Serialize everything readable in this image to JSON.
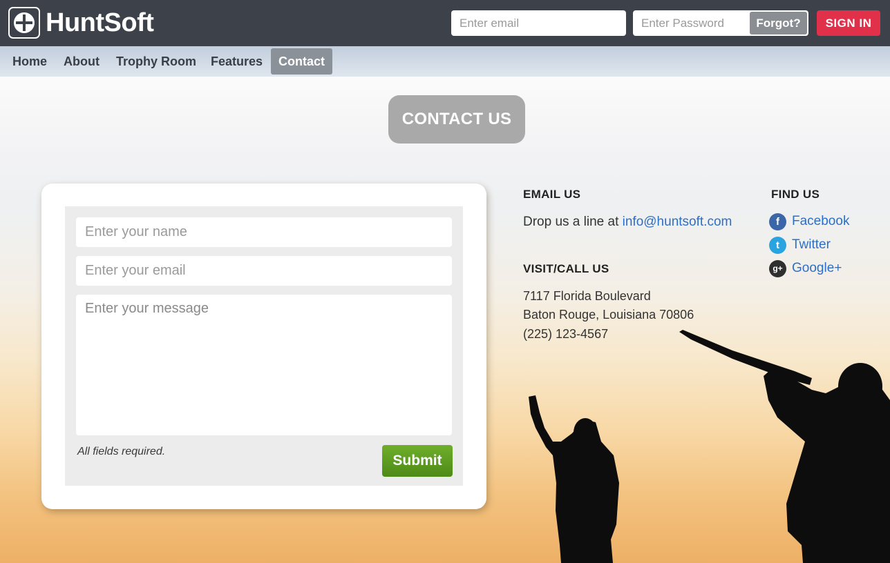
{
  "brand": {
    "name": "HuntSoft"
  },
  "header": {
    "email_placeholder": "Enter email",
    "password_placeholder": "Enter Password",
    "forgot_label": "Forgot?",
    "signin_label": "SIGN IN"
  },
  "nav": {
    "items": [
      {
        "label": "Home",
        "active": false
      },
      {
        "label": "About",
        "active": false
      },
      {
        "label": "Trophy Room",
        "active": false
      },
      {
        "label": "Features",
        "active": false
      },
      {
        "label": "Contact",
        "active": true
      }
    ]
  },
  "page": {
    "title": "CONTACT US"
  },
  "form": {
    "name_placeholder": "Enter your name",
    "email_placeholder": "Enter your email",
    "message_placeholder": "Enter your message",
    "required_note": "All fields required.",
    "submit_label": "Submit"
  },
  "contact": {
    "email_heading": "EMAIL US",
    "email_prefix": "Drop us a line at",
    "email_address": "info@huntsoft.com",
    "visit_heading": "VISIT/CALL US",
    "address_line1": "7117 Florida Boulevard",
    "address_line2": "Baton Rouge, Louisiana 70806",
    "phone": "(225) 123-4567"
  },
  "social": {
    "heading": "FIND US",
    "links": [
      {
        "label": "Facebook",
        "icon": "facebook-icon",
        "glyph": "f"
      },
      {
        "label": "Twitter",
        "icon": "twitter-icon",
        "glyph": "t"
      },
      {
        "label": "Google+",
        "icon": "google-plus-icon",
        "glyph": "g+"
      }
    ]
  },
  "colors": {
    "topbar": "#3d424a",
    "signin": "#e0304a",
    "submit": "#5a9a1f",
    "link": "#2c6fc9",
    "nav_active": "#8a9199"
  }
}
